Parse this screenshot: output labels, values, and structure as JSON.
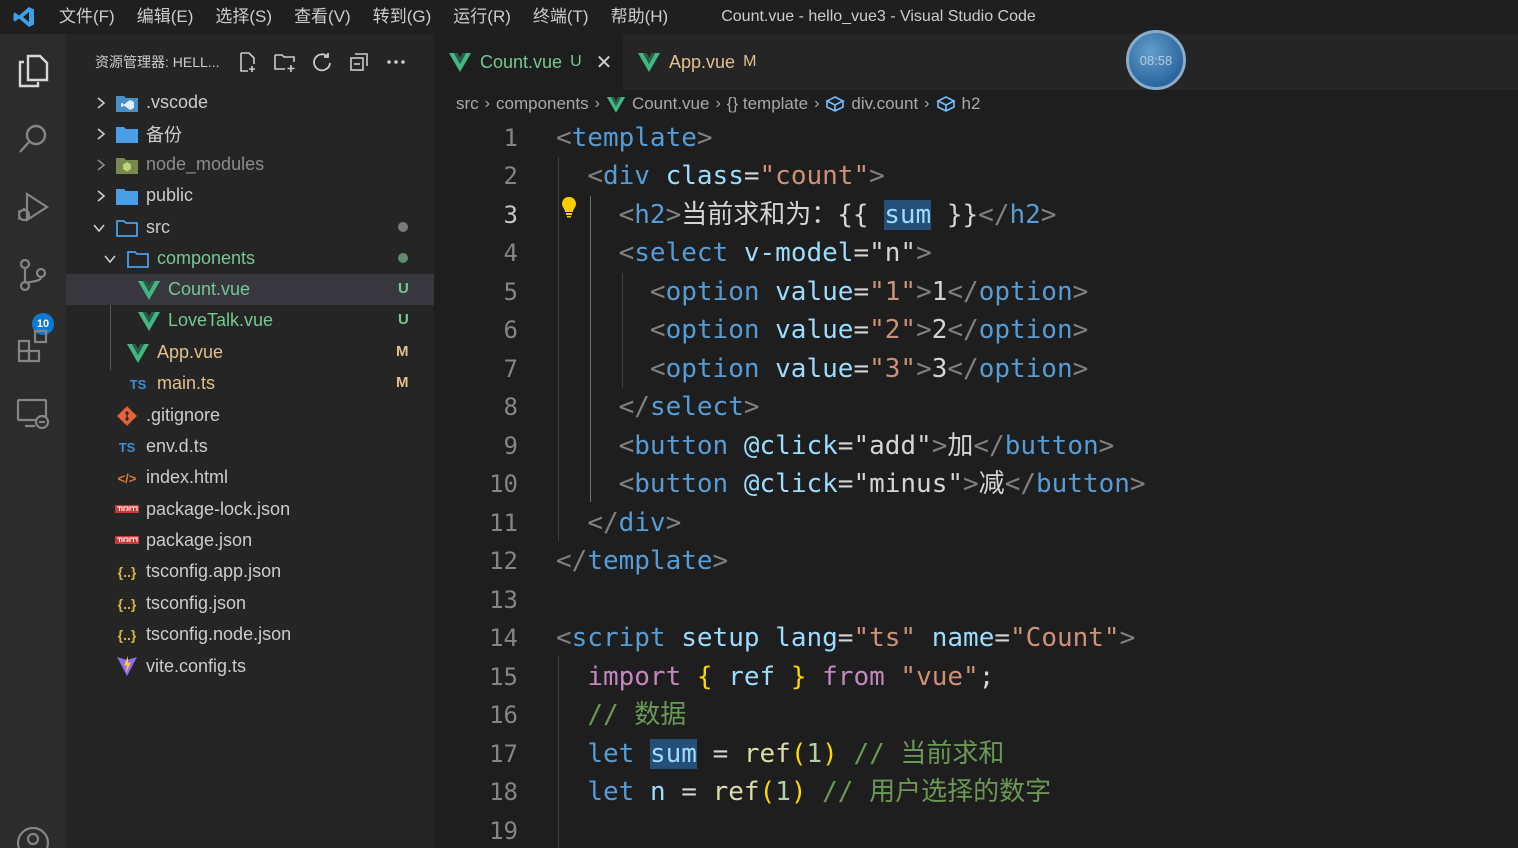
{
  "window": {
    "title": "Count.vue - hello_vue3 - Visual Studio Code"
  },
  "menu": [
    "文件(F)",
    "编辑(E)",
    "选择(S)",
    "查看(V)",
    "转到(G)",
    "运行(R)",
    "终端(T)",
    "帮助(H)"
  ],
  "activity_bar": {
    "source_control_badge": "10"
  },
  "sidebar": {
    "title": "资源管理器: HELL...",
    "tree": [
      {
        "name": ".vscode",
        "icon": "vscode-folder-icon",
        "status": ""
      },
      {
        "name": "备份",
        "icon": "folder-icon",
        "status": ""
      },
      {
        "name": "node_modules",
        "icon": "node-folder-icon",
        "status": ""
      },
      {
        "name": "public",
        "icon": "folder-icon",
        "status": ""
      },
      {
        "name": "src",
        "icon": "folder-open-icon",
        "status": "dot"
      },
      {
        "name": "components",
        "icon": "folder-open-icon",
        "status": "dot"
      },
      {
        "name": "Count.vue",
        "icon": "vue-icon",
        "status": "U"
      },
      {
        "name": "LoveTalk.vue",
        "icon": "vue-icon",
        "status": "U"
      },
      {
        "name": "App.vue",
        "icon": "vue-icon",
        "status": "M"
      },
      {
        "name": "main.ts",
        "icon": "ts-icon",
        "status": "M"
      },
      {
        "name": ".gitignore",
        "icon": "git-icon",
        "status": ""
      },
      {
        "name": "env.d.ts",
        "icon": "ts-icon",
        "status": ""
      },
      {
        "name": "index.html",
        "icon": "html-icon",
        "status": ""
      },
      {
        "name": "package-lock.json",
        "icon": "npm-icon",
        "status": ""
      },
      {
        "name": "package.json",
        "icon": "npm-icon",
        "status": ""
      },
      {
        "name": "tsconfig.app.json",
        "icon": "json-icon",
        "status": ""
      },
      {
        "name": "tsconfig.json",
        "icon": "json-icon",
        "status": ""
      },
      {
        "name": "tsconfig.node.json",
        "icon": "json-icon",
        "status": ""
      },
      {
        "name": "vite.config.ts",
        "icon": "vite-icon",
        "status": ""
      }
    ]
  },
  "tabs": [
    {
      "label": "Count.vue",
      "status": "U",
      "active": true
    },
    {
      "label": "App.vue",
      "status": "M",
      "active": false
    }
  ],
  "breadcrumb": [
    "src",
    "components",
    "Count.vue",
    "{} template",
    "div.count",
    "h2"
  ],
  "clock": "08:58",
  "editor": {
    "line_numbers": [
      "1",
      "2",
      "3",
      "4",
      "5",
      "6",
      "7",
      "8",
      "9",
      "10",
      "11",
      "12",
      "13",
      "14",
      "15",
      "16",
      "17",
      "18",
      "19"
    ],
    "active_line": "3",
    "code": {
      "l3_text": "当前求和为：",
      "l9_text": "加",
      "l10_text": "减",
      "l16_comment": "// 数据",
      "l17_comment": "// 当前求和",
      "l18_comment": "// 用户选择的数字"
    }
  }
}
